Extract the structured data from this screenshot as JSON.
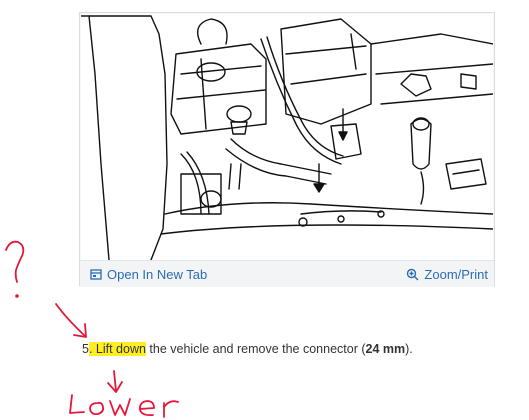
{
  "figure": {
    "open_tab_label": "Open In New Tab",
    "zoom_label": "Zoom/Print",
    "icons": [
      "open-tab-icon",
      "magnifier-icon"
    ],
    "link_color": "#2a6db5"
  },
  "step": {
    "number": "5",
    "highlight_text": ". Lift down",
    "text_before_bold": " the vehicle and remove the connector (",
    "bold_text": "24 mm",
    "text_after": ").",
    "highlight_color": "#ffee22"
  },
  "annotations": {
    "handwritten_text": "Lower",
    "question_mark": "?",
    "ink_color": "#e8173a"
  }
}
